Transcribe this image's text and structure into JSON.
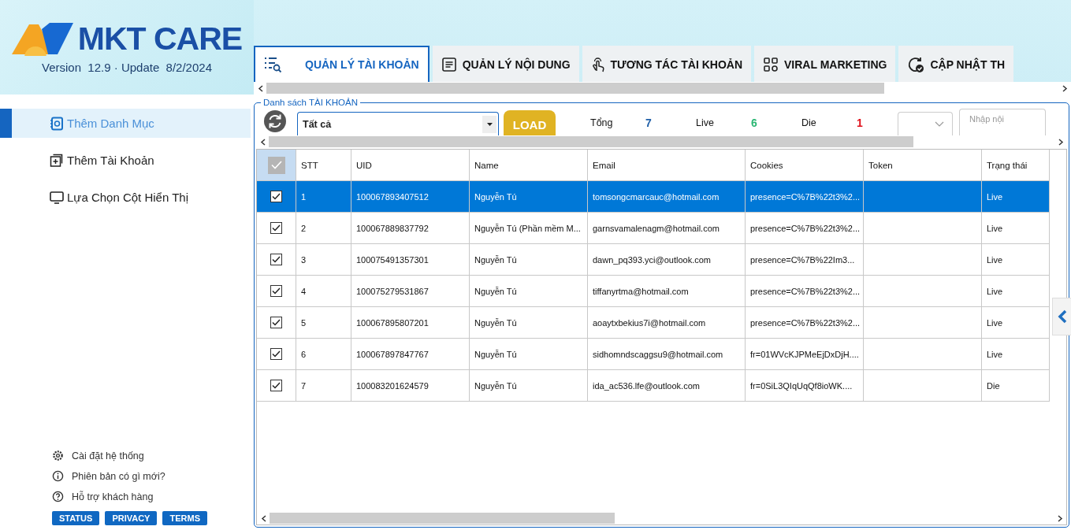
{
  "brand": {
    "name": "MKT CARE",
    "version": "Version  12.9 · Update  8/2/2024"
  },
  "sidebar": {
    "items": [
      {
        "label": "Thêm Danh Mục",
        "kind": "catalog",
        "selected": true
      },
      {
        "label": "Thêm Tài Khoản",
        "kind": "add",
        "selected": false
      },
      {
        "label": "Lựa Chọn Cột Hiển Thị",
        "kind": "monitor",
        "selected": false
      }
    ],
    "footer_links": [
      {
        "label": "Cài đặt hệ thống",
        "kind": "gear"
      },
      {
        "label": "Phiên bản có gì mới?",
        "kind": "info"
      },
      {
        "label": "Hỗ trợ khách hàng",
        "kind": "help"
      }
    ],
    "footer_buttons": [
      "STATUS",
      "PRIVACY",
      "TERMS"
    ]
  },
  "tabs": [
    {
      "label": "QUẢN LÝ TÀI KHOẢN",
      "kind": "list",
      "selected": true
    },
    {
      "label": "QUẢN LÝ NỘI DUNG",
      "kind": "doc",
      "selected": false
    },
    {
      "label": "TƯƠNG TÁC TÀI KHOẢN",
      "kind": "hand",
      "selected": false
    },
    {
      "label": "VIRAL MARKETING",
      "kind": "grid",
      "selected": false
    },
    {
      "label": "CẬP NHẬT TH",
      "kind": "refresh",
      "selected": false
    }
  ],
  "panel": {
    "title": "Danh sách TÀI KHOẢN",
    "filter": {
      "value": "Tất cả"
    },
    "load_button": "LOAD",
    "stats": [
      {
        "label": "Tổng",
        "value": "7",
        "color": "#1f5fa8"
      },
      {
        "label": "Live",
        "value": "6",
        "color": "#2bb673"
      },
      {
        "label": "Die",
        "value": "1",
        "color": "#e0101a"
      }
    ],
    "search": {
      "placeholder": "Nhập nội"
    }
  },
  "table": {
    "header_checked": true,
    "columns": [
      "STT",
      "UID",
      "Name",
      "Email",
      "Cookies",
      "Token",
      "Trạng thái"
    ],
    "rows": [
      {
        "checked": true,
        "selected": true,
        "cells": [
          "1",
          "100067893407512",
          "Nguyễn Tú",
          "tomsongcmarcauc@hotmail.com",
          "presence=C%7B%22t3%2...",
          "",
          "Live"
        ]
      },
      {
        "checked": true,
        "selected": false,
        "cells": [
          "2",
          "100067889837792",
          "Nguyễn Tú (Phần mềm M...",
          "garnsvamalenagm@hotmail.com",
          "presence=C%7B%22t3%2...",
          "",
          "Live"
        ]
      },
      {
        "checked": true,
        "selected": false,
        "cells": [
          "3",
          "100075491357301",
          "Nguyễn Tú",
          "dawn_pq393.yci@outlook.com",
          "presence=C%7B%22Im3...",
          "",
          "Live"
        ]
      },
      {
        "checked": true,
        "selected": false,
        "cells": [
          "4",
          "100075279531867",
          "Nguyễn Tú",
          "tiffanyrtma@hotmail.com",
          "presence=C%7B%22t3%2...",
          "",
          "Live"
        ]
      },
      {
        "checked": true,
        "selected": false,
        "cells": [
          "5",
          "100067895807201",
          "Nguyễn Tú",
          "aoaytxbekius7i@hotmail.com",
          "presence=C%7B%22t3%2...",
          "",
          "Live"
        ]
      },
      {
        "checked": true,
        "selected": false,
        "cells": [
          "6",
          "100067897847767",
          "Nguyễn Tú",
          "sidhomndscaggsu9@hotmail.com",
          "fr=01WVcKJPMeEjDxDjH....",
          "",
          "Live"
        ]
      },
      {
        "checked": true,
        "selected": false,
        "cells": [
          "7",
          "100083201624579",
          "Nguyễn Tú",
          "ida_ac536.lfe@outlook.com",
          "fr=0SiL3QIqUqQf8ioWK....",
          "",
          "Die"
        ]
      }
    ]
  }
}
